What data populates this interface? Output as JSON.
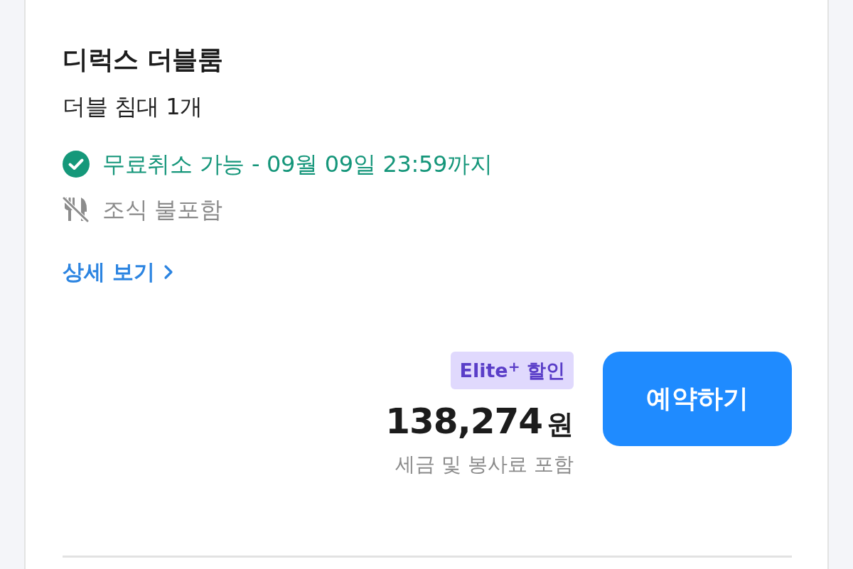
{
  "room": {
    "name": "디럭스 더블룸",
    "bed": "더블 침대 1개"
  },
  "features": [
    {
      "kind": "cancellation",
      "text": "무료취소 가능 - 09월 09일 23:59까지"
    },
    {
      "kind": "breakfast",
      "text": "조식 불포함"
    }
  ],
  "details_link": "상세 보기",
  "price": {
    "badge": "Elite$^{+}$ 할인",
    "amount": "138,274",
    "currency": "원",
    "note": "세금 및 봉사료 포함"
  },
  "book_button": "예약하기"
}
